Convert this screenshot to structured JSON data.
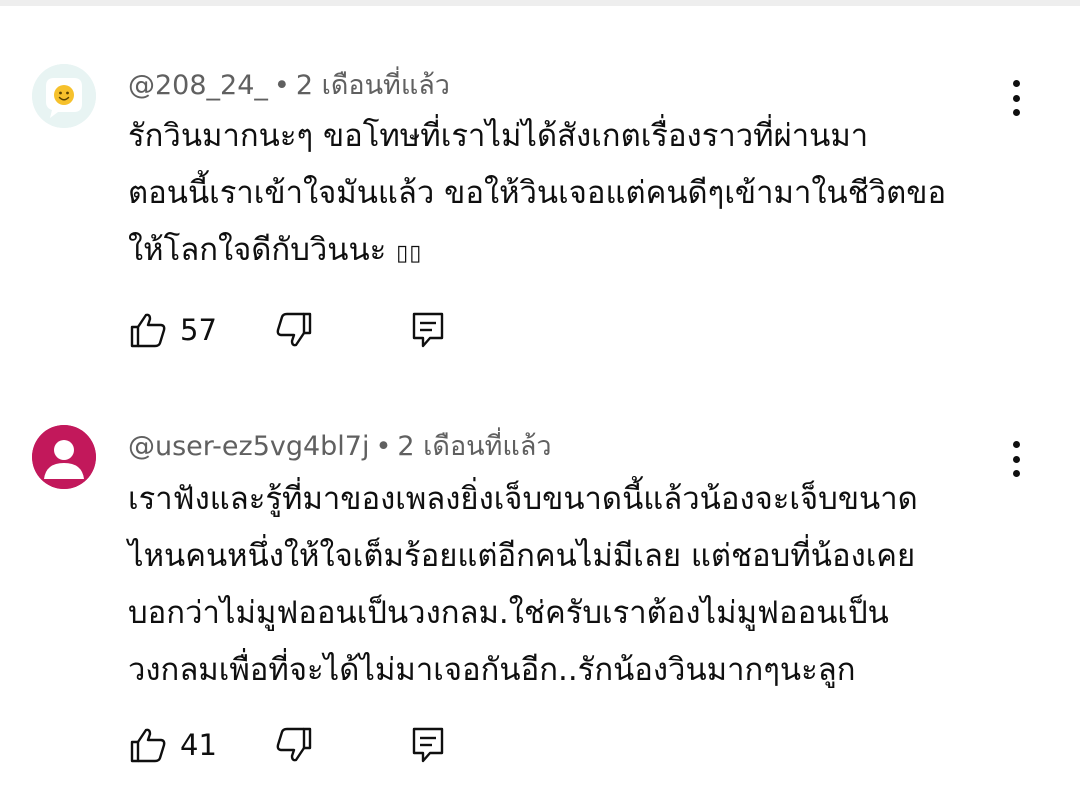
{
  "comments": [
    {
      "author": "@208_24_",
      "separator": "•",
      "time": "2 เดือนที่แล้ว",
      "lines": [
        "รักวินมากนะๆ ขอโทษที่เราไม่ได้สังเกตเรื่องราวที่ผ่านมา",
        "ตอนนี้เราเข้าใจมันแล้ว ขอให้วินเจอแต่คนดีๆเข้ามาในชีวิตขอ",
        "ให้โลกใจดีกับวินนะ"
      ],
      "emoji_fallback": "▯▯",
      "likes": "57",
      "avatar_color": "#e8f4f3",
      "icons": {
        "avatar": "smiley-icon",
        "like": "thumbs-up-icon",
        "dislike": "thumbs-down-icon",
        "reply": "reply-icon",
        "menu": "more-vert-icon"
      }
    },
    {
      "author": "@user-ez5vg4bl7j",
      "separator": "•",
      "time": "2 เดือนที่แล้ว",
      "lines": [
        "เราฟังและรู้ที่มาของเพลงยิ่งเจ็บขนาดนี้แล้วน้องจะเจ็บขนาด",
        "ไหนคนหนึ่งให้ใจเต็มร้อยแต่อีกคนไม่มีเลย แต่ชอบที่น้องเคย",
        "บอกว่าไม่มูฟออนเป็นวงกลม.ใช่ครับเราต้องไม่มูฟออนเป็น",
        "วงกลมเพื่อที่จะได้ไม่มาเจอกันอีก..รักน้องวินมากๆนะลูก"
      ],
      "likes": "41",
      "avatar_color": "#c2185b",
      "icons": {
        "avatar": "default-user-icon",
        "like": "thumbs-up-icon",
        "dislike": "thumbs-down-icon",
        "reply": "reply-icon",
        "menu": "more-vert-icon"
      }
    }
  ]
}
